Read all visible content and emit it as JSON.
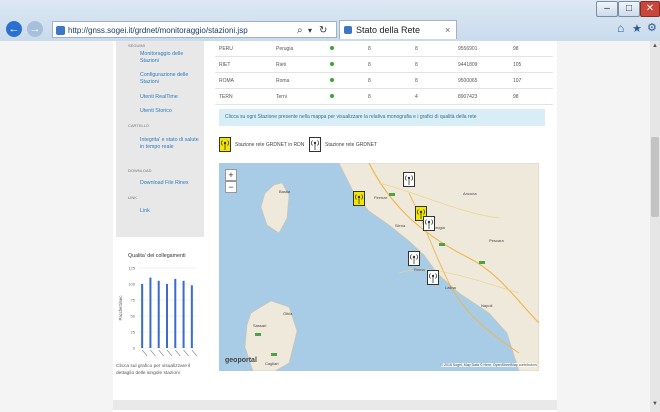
{
  "browser": {
    "url": "http://gnss.sogei.it/grdnet/monitoraggio/stazioni.jsp",
    "tab_title": "Stato della Rete",
    "tab_close": "×",
    "search_glyph": "⌕",
    "dropdown_glyph": "▾",
    "refresh_glyph": "↻",
    "home_glyph": "⌂",
    "fav_glyph": "★",
    "settings_glyph": "⚙",
    "back_glyph": "←",
    "forward_glyph": "→",
    "minimize": "–",
    "maximize": "□",
    "close": "✕"
  },
  "sidebar": {
    "sections": [
      {
        "title": "SEGUIMI",
        "links": []
      },
      {
        "title": "",
        "links": [
          "Monitoraggio delle Stazioni",
          "Configurazione delle Stazioni",
          "Utenti RealTime",
          "Utenti Storico"
        ]
      },
      {
        "title": "CARTELLO",
        "links": [
          "Integrita' e stato di salute in tempo reale"
        ]
      },
      {
        "title": "DOWNLOAD",
        "links": [
          "Download File Rinex"
        ]
      },
      {
        "title": "LINK",
        "links": [
          "Link"
        ]
      }
    ]
  },
  "quality_chart": {
    "title": "Qualita' dei collegamenti",
    "ylabel": "Pacchetti/sec",
    "yticks": [
      "125",
      "100",
      "75",
      "50",
      "25",
      "0"
    ],
    "caption": "Clicca sul grafico per visualizzare il dettaglio delle singole stazioni"
  },
  "chart_data": {
    "type": "bar",
    "title": "Qualita' dei collegamenti",
    "ylabel": "Pacchetti/sec",
    "ylim": [
      0,
      125
    ],
    "values": [
      100,
      110,
      105,
      100,
      108,
      105,
      98
    ]
  },
  "stations_table": {
    "rows": [
      [
        "PERU",
        "Perugia",
        "8",
        "8",
        "9556901",
        "98"
      ],
      [
        "RIET",
        "Rieti",
        "8",
        "8",
        "9441809",
        "105"
      ],
      [
        "ROMA",
        "Roma",
        "8",
        "8",
        "9500065",
        "107"
      ],
      [
        "TERN",
        "Terni",
        "8",
        "4",
        "8907423",
        "98"
      ]
    ]
  },
  "info_text": "Clicca su ogni Stazione presente nella mappa per visualizzare la relativa monografia e i grafici di qualità della rete",
  "legend": {
    "ron": "Stazione rete GRDNET in RDN",
    "grdnet": "Stazione rete GRDNET"
  },
  "map": {
    "zoom_in": "+",
    "zoom_out": "−",
    "brand": "geoportal",
    "attribution": "© 2016 Sogei, Map Data © Here, OpenStreetMap contributors",
    "labels": [
      "Firenze",
      "Ancona",
      "Perugia",
      "Roma",
      "Napoli",
      "Pescara",
      "Siena",
      "Cagliari",
      "Olbia",
      "Bastia",
      "Sassari",
      "Latina"
    ],
    "colors": {
      "sea": "#a8cbe6",
      "land": "#efe9db",
      "ron_marker": "#f2e600",
      "grdnet_marker": "#ffffff"
    }
  }
}
